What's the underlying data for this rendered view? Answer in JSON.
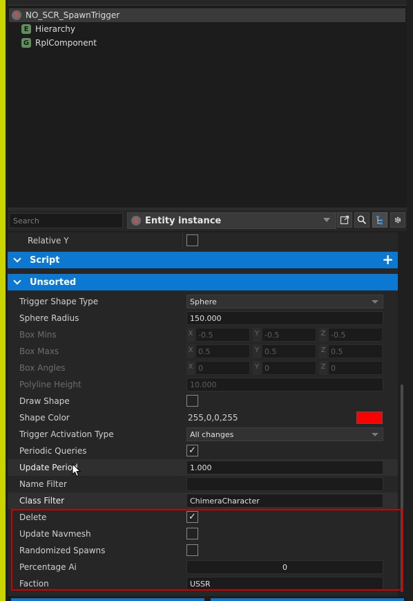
{
  "hierarchy": {
    "items": [
      {
        "badge": "S",
        "label": "NO_SCR_SpawnTrigger"
      },
      {
        "badge": "E",
        "label": "Hierarchy"
      },
      {
        "badge": "G",
        "label": "RplComponent"
      }
    ]
  },
  "toolbar": {
    "search_placeholder": "Search",
    "entity_badge": "S",
    "entity_label": "Entity instance"
  },
  "properties": {
    "relative_y": {
      "label": "Relative Y",
      "checked": false
    },
    "script_section": "Script",
    "unsorted_section": "Unsorted",
    "trigger_shape_type": {
      "label": "Trigger Shape Type",
      "value": "Sphere"
    },
    "sphere_radius": {
      "label": "Sphere Radius",
      "value": "150.000"
    },
    "box_mins": {
      "label": "Box Mins",
      "x": "-0.5",
      "y": "-0.5",
      "z": "-0.5"
    },
    "box_maxs": {
      "label": "Box Maxs",
      "x": "0.5",
      "y": "0.5",
      "z": "0.5"
    },
    "box_angles": {
      "label": "Box Angles",
      "x": "0",
      "y": "0",
      "z": "0"
    },
    "polyline_height": {
      "label": "Polyline  Height",
      "value": "10.000"
    },
    "draw_shape": {
      "label": "Draw Shape",
      "checked": false
    },
    "shape_color": {
      "label": "Shape Color",
      "value": "255,0,0,255",
      "swatch": "#ff0000"
    },
    "trigger_activation_type": {
      "label": "Trigger Activation Type",
      "value": "All changes"
    },
    "periodic_queries": {
      "label": "Periodic Queries",
      "checked": true
    },
    "update_period": {
      "label": "Update Period",
      "value": "1.000"
    },
    "name_filter": {
      "label": "Name Filter",
      "value": ""
    },
    "class_filter": {
      "label": "Class Filter",
      "value": "ChimeraCharacter"
    },
    "delete": {
      "label": "Delete",
      "checked": true
    },
    "update_navmesh": {
      "label": "Update Navmesh",
      "checked": false
    },
    "randomized_spawns": {
      "label": "Randomized Spawns",
      "checked": false
    },
    "percentage_ai": {
      "label": "Percentage Ai",
      "value": "0"
    },
    "faction": {
      "label": "Faction",
      "value": "USSR"
    }
  },
  "axes": {
    "x": "X",
    "y": "Y",
    "z": "Z"
  },
  "icons": {
    "external": "external-link-icon",
    "search": "search-icon",
    "hierarchy": "hierarchy-icon",
    "settings": "gear-icon"
  },
  "colors": {
    "accent": "#0c78d2",
    "highlight_box": "#d40000"
  }
}
